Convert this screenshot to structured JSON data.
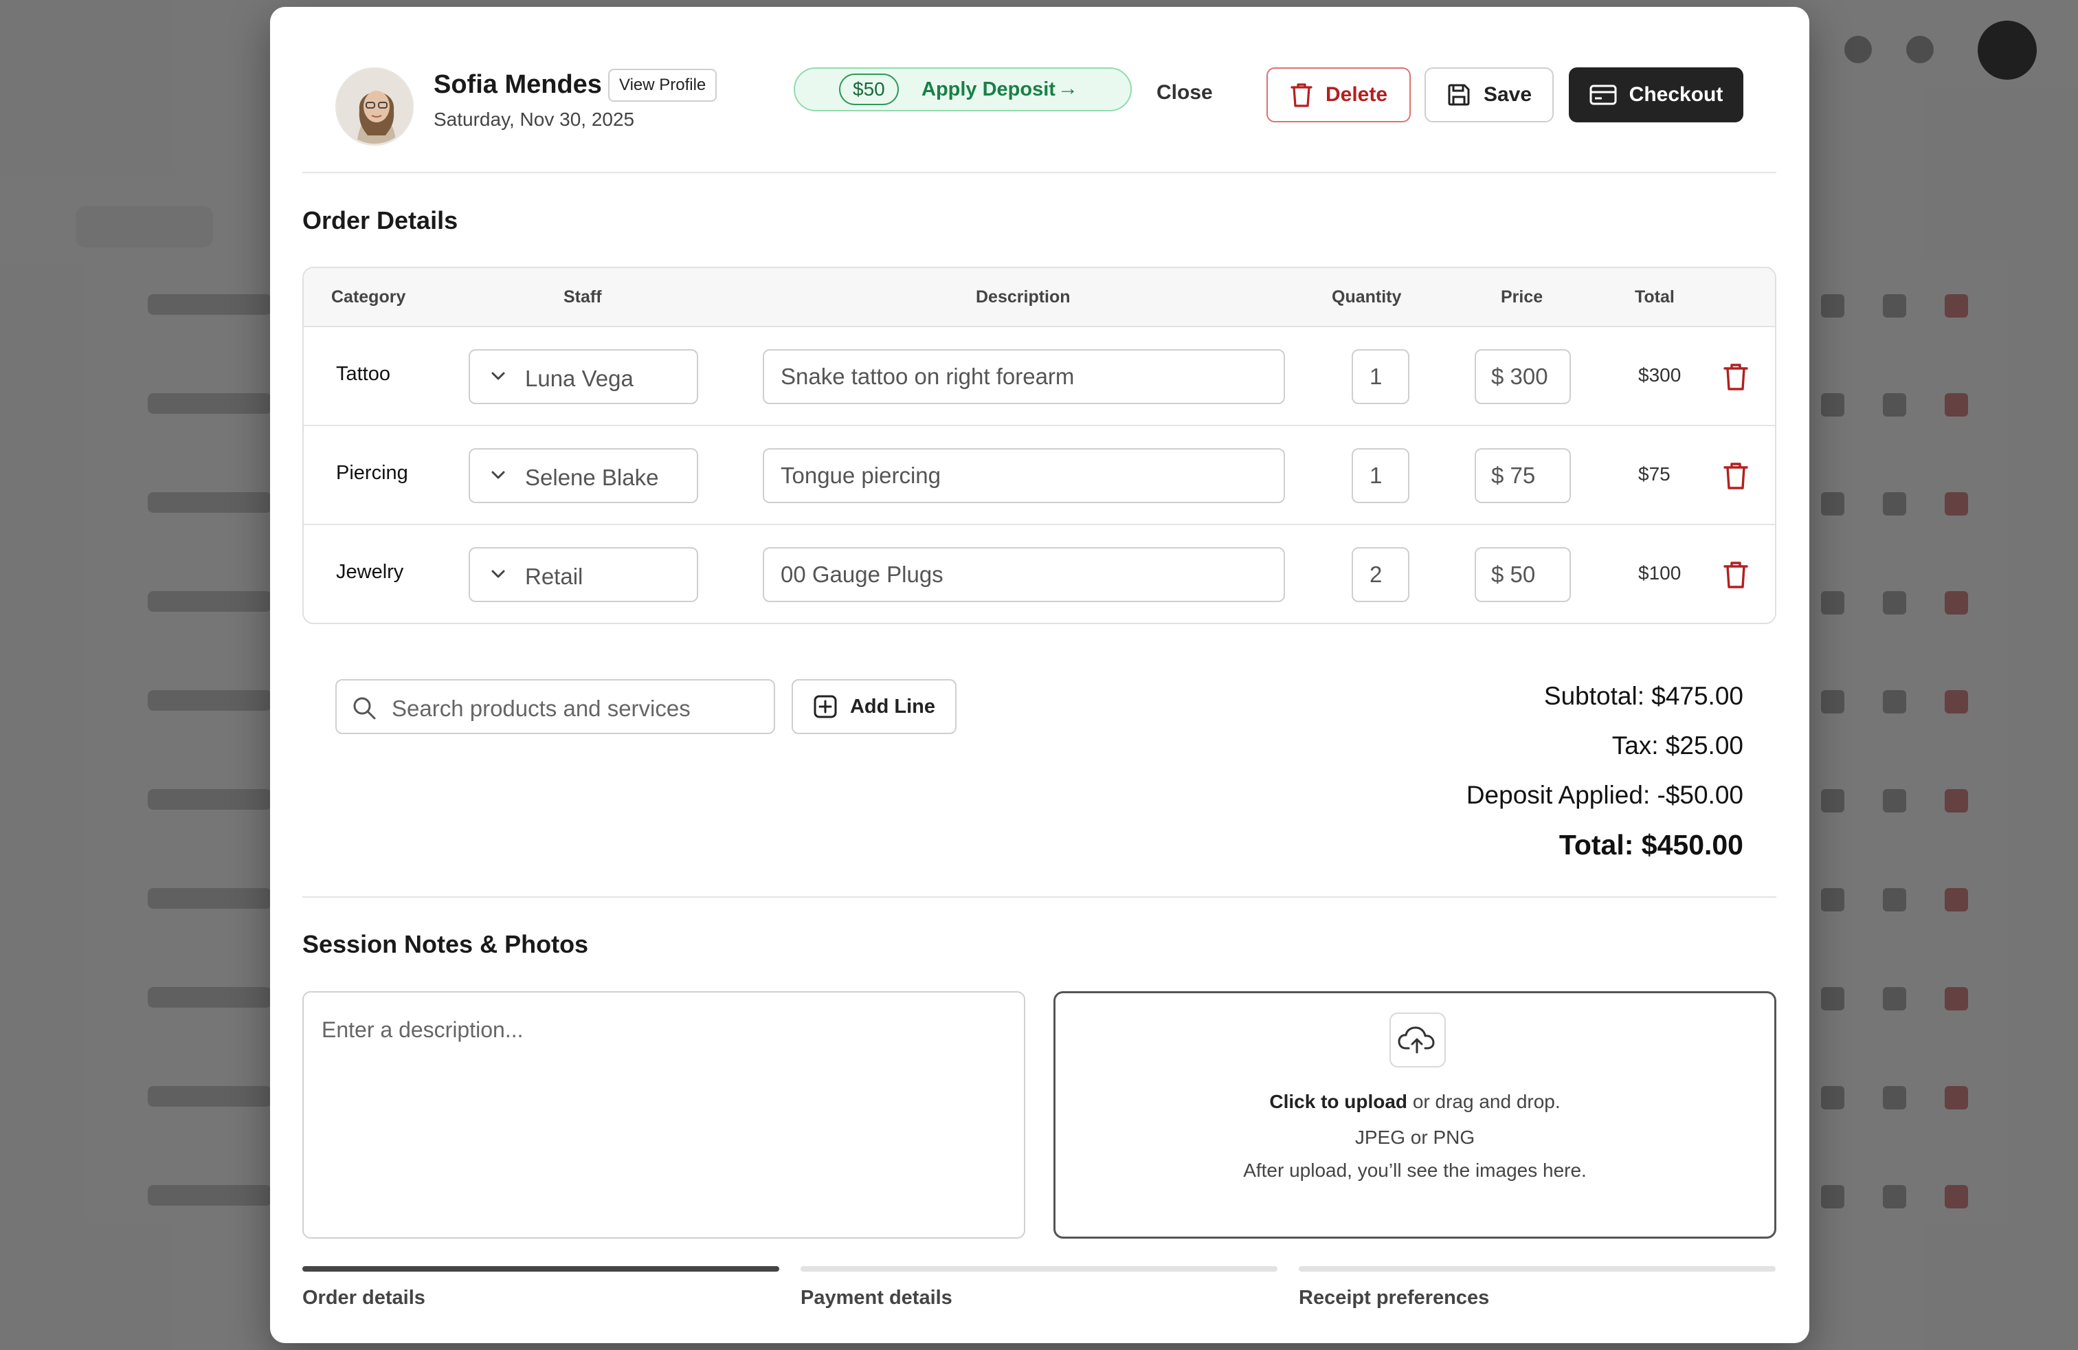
{
  "customer": {
    "name": "Sofia Mendes",
    "view_profile_label": "View Profile",
    "date": "Saturday, Nov 30, 2025"
  },
  "deposit": {
    "amount": "$50",
    "label": "Apply Deposit",
    "arrow": "→"
  },
  "actions": {
    "close": "Close",
    "delete": "Delete",
    "save": "Save",
    "checkout": "Checkout"
  },
  "order": {
    "title": "Order Details",
    "columns": {
      "category": "Category",
      "staff": "Staff",
      "description": "Description",
      "quantity": "Quantity",
      "price": "Price",
      "total": "Total"
    },
    "rows": [
      {
        "category": "Tattoo",
        "staff": "Luna Vega",
        "description": "Snake tattoo on right forearm",
        "quantity": "1",
        "price": "$ 300",
        "total": "$300"
      },
      {
        "category": "Piercing",
        "staff": "Selene Blake",
        "description": "Tongue piercing",
        "quantity": "1",
        "price": "$ 75",
        "total": "$75"
      },
      {
        "category": "Jewelry",
        "staff": "Retail",
        "description": "00 Gauge Plugs",
        "quantity": "2",
        "price": "$ 50",
        "total": "$100"
      }
    ],
    "search_placeholder": "Search products and services",
    "add_line_label": "Add Line"
  },
  "summary": {
    "subtotal": "Subtotal: $475.00",
    "tax": "Tax: $25.00",
    "deposit_applied": "Deposit Applied: -$50.00",
    "total": "Total: $450.00"
  },
  "notes": {
    "title": "Session Notes & Photos",
    "description_placeholder": "Enter a description...",
    "upload_click": "Click to upload",
    "upload_rest": " or drag and drop.",
    "upload_formats": "JPEG or PNG",
    "upload_hint": "After upload, you’ll see the images here."
  },
  "steps": [
    {
      "label": "Order details",
      "active": true
    },
    {
      "label": "Payment details",
      "active": false
    },
    {
      "label": "Receipt preferences",
      "active": false
    }
  ],
  "colors": {
    "accent_green": "#188048",
    "danger_red": "#b42020",
    "checkout_bg": "#232323"
  }
}
